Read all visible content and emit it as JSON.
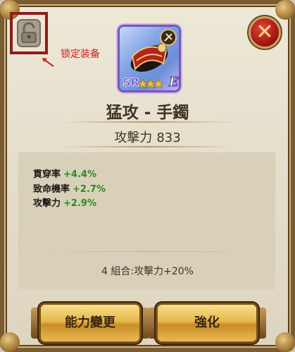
{
  "annotation": {
    "text": "锁定装备"
  },
  "item": {
    "name": "猛攻 - 手鐲",
    "rarity": "SR",
    "grade_letter": "E",
    "stars": 3
  },
  "attack": {
    "label": "攻擊力",
    "value": "833"
  },
  "stats": [
    {
      "label": "貫穿率",
      "value": "+4.4%"
    },
    {
      "label": "致命機率",
      "value": "+2.7%"
    },
    {
      "label": "攻擊力",
      "value": "+2.9%"
    }
  ],
  "combo": {
    "text": "4 組合:攻擊力+20%"
  },
  "buttons": {
    "change": "能力變更",
    "enhance": "強化",
    "close_icon": "close-icon",
    "lock_icon": "unlocked-padlock-icon"
  },
  "colors": {
    "stat_value": "#2b8a22",
    "annotation": "#d02020",
    "frame": "#7a5c33"
  }
}
